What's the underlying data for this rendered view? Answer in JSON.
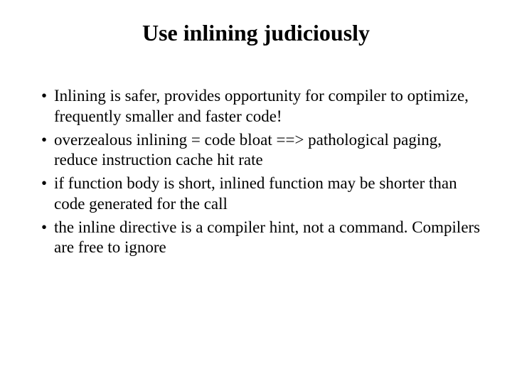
{
  "title": "Use inlining judiciously",
  "bullets": [
    "Inlining is safer, provides opportunity for compiler to optimize, frequently smaller and faster code!",
    "overzealous inlining = code bloat ==> pathological paging, reduce instruction cache hit rate",
    "if function body is short, inlined function may be shorter than code generated for the call",
    "the inline directive is a compiler hint, not a command. Compilers are free to ignore"
  ]
}
